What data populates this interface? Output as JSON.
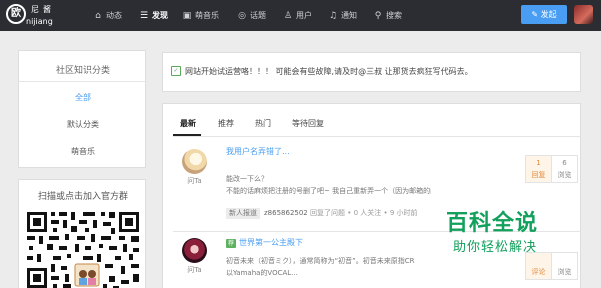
{
  "app": {
    "logo_glyph": "欧",
    "logo_name": "尼酱",
    "logo_subtitle": "nijiang"
  },
  "nav": {
    "items": [
      {
        "label": "动态",
        "icon": "home-icon",
        "active": false
      },
      {
        "label": "发现",
        "icon": "list-icon",
        "active": true
      },
      {
        "label": "萌音乐",
        "icon": "music-icon",
        "active": false
      },
      {
        "label": "话题",
        "icon": "chat-icon",
        "active": false
      },
      {
        "label": "用户",
        "icon": "user-icon",
        "active": false
      },
      {
        "label": "通知",
        "icon": "bell-icon",
        "active": false
      },
      {
        "label": "搜索",
        "icon": "search-icon",
        "active": false
      }
    ],
    "post_button": "发起",
    "accent_color": "#499ef3"
  },
  "sidebar": {
    "title": "社区知识分类",
    "items": [
      {
        "label": "全部",
        "active": true
      },
      {
        "label": "默认分类",
        "active": false
      },
      {
        "label": "萌音乐",
        "active": false
      }
    ],
    "qr_title": "扫描或点击加入官方群"
  },
  "notice": {
    "text": "网站开始试运营咯！！！ 可能会有些故障,请及时@三叔 让那货去疯狂写代码去。"
  },
  "feed": {
    "tabs": [
      {
        "label": "最新",
        "active": true
      },
      {
        "label": "推荐",
        "active": false
      },
      {
        "label": "热门",
        "active": false
      },
      {
        "label": "等待回复",
        "active": false
      }
    ],
    "questions": [
      {
        "title": "我用户名弄错了...",
        "asker": "问Ta",
        "excerpt_1": "能改一下么？",
        "excerpt_2": "不能的话麻烦把注册的号删了吧~ 我自己重新弄一个（因为邮箱的问题",
        "topic": "新人报道",
        "user": "z865862502",
        "meta": " 回复了问题 • 0 人关注 • 9 小时前",
        "answers": "1",
        "answers_label": "回复",
        "views": "6",
        "views_label": "浏览"
      },
      {
        "tag": "荐",
        "title": "世界第一公主殿下",
        "asker": "问Ta",
        "excerpt_1": "初音未来（初音ミク），通常简称为“初音”。初音未来原指CR",
        "excerpt_2": "以Yamaha的VOCAL...",
        "answers_label": "评论",
        "views_label": "浏览"
      }
    ]
  },
  "watermark": {
    "title": "百科全说",
    "subtitle": "助你轻松解决"
  }
}
